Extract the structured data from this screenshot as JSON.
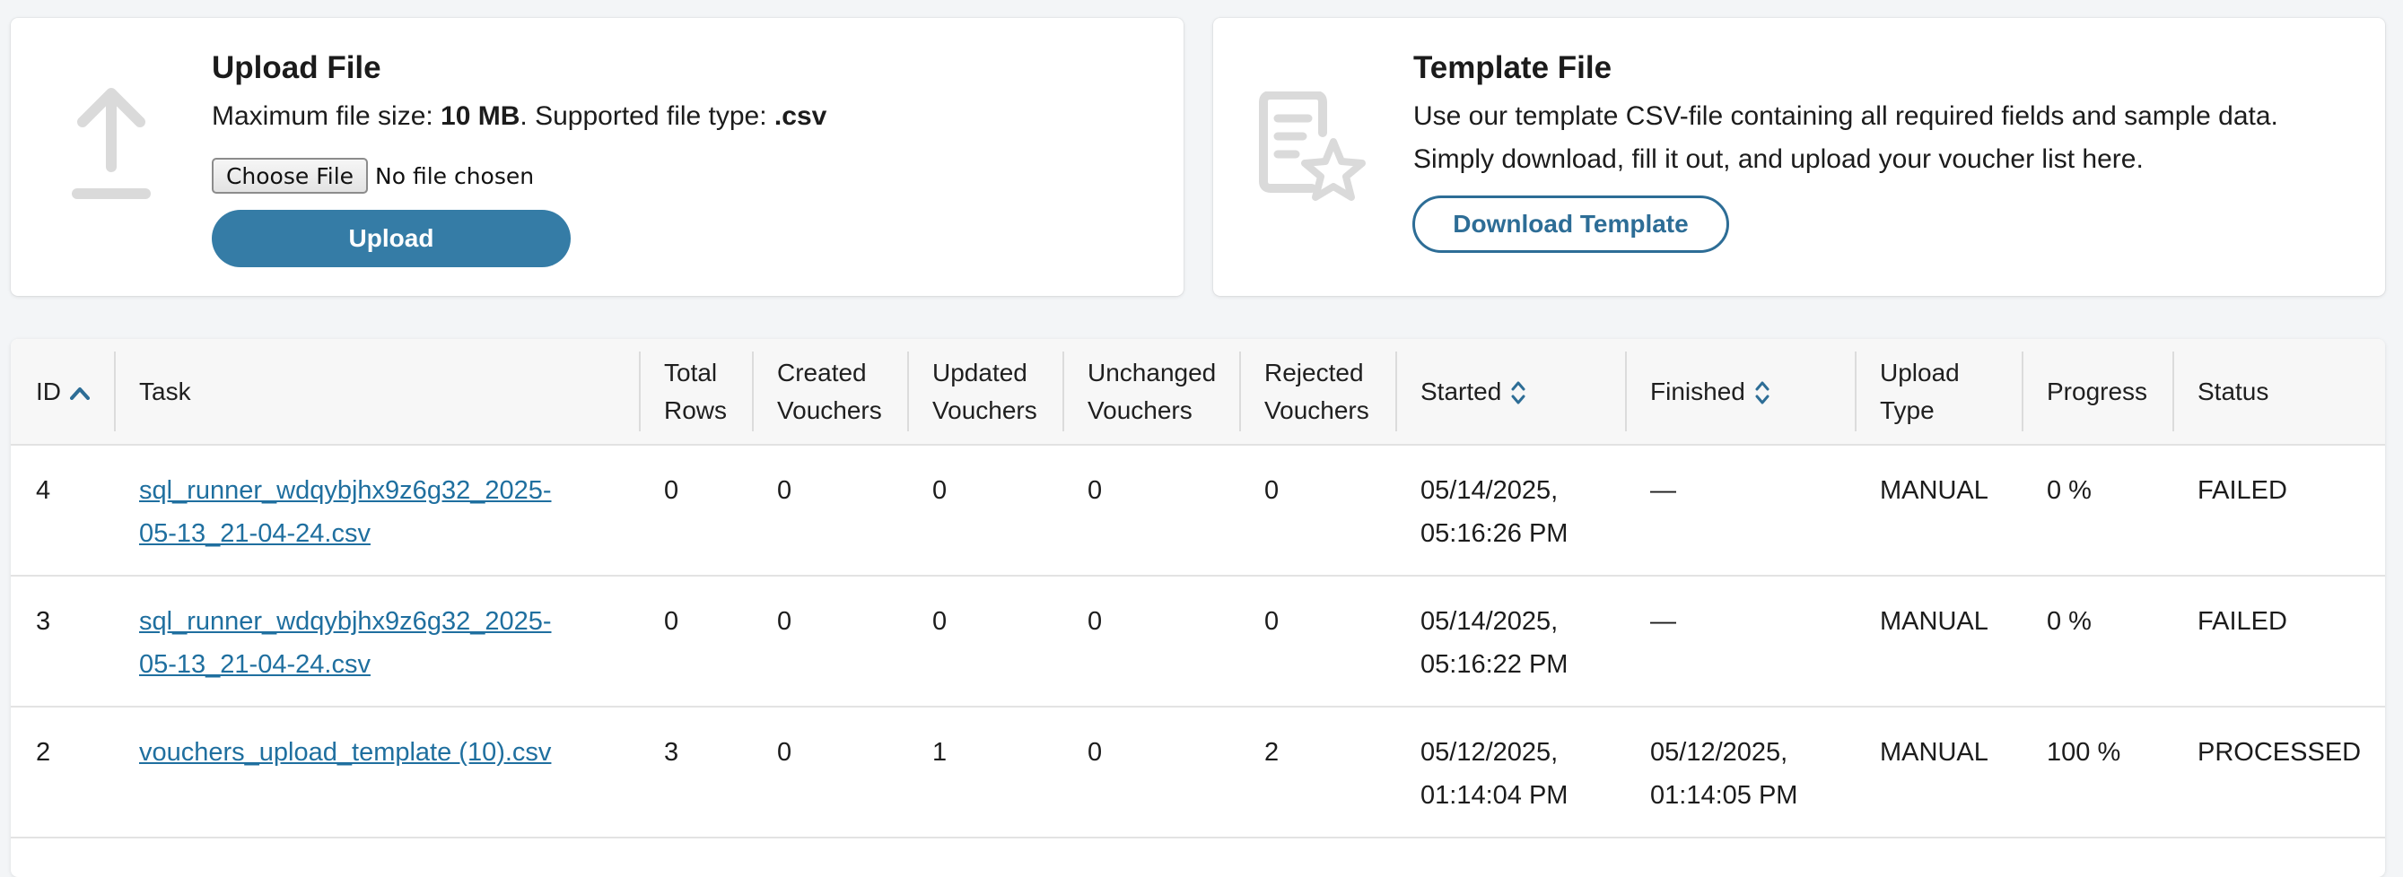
{
  "upload": {
    "title": "Upload File",
    "desc_prefix": "Maximum file size: ",
    "max_size": "10 MB",
    "desc_middle": ". Supported file type: ",
    "file_type": ".csv",
    "choose_file_label": "Choose File",
    "no_file_text": "No file chosen",
    "upload_button": "Upload"
  },
  "template": {
    "title": "Template File",
    "line1": "Use our template CSV-file containing all required fields and sample data.",
    "line2": "Simply download, fill it out, and upload your voucher list here.",
    "download_button": "Download Template"
  },
  "table": {
    "headers": {
      "id": "ID",
      "task": "Task",
      "total_rows_1": "Total",
      "total_rows_2": "Rows",
      "created_1": "Created",
      "created_2": "Vouchers",
      "updated_1": "Updated",
      "updated_2": "Vouchers",
      "unchanged_1": "Unchanged",
      "unchanged_2": "Vouchers",
      "rejected_1": "Rejected",
      "rejected_2": "Vouchers",
      "started": "Started",
      "finished": "Finished",
      "upload_type_1": "Upload",
      "upload_type_2": "Type",
      "progress": "Progress",
      "status": "Status"
    },
    "rows": [
      {
        "id": "4",
        "task_1": "sql_runner_wdqybjhx9z6g32_2025-",
        "task_2": "05-13_21-04-24.csv",
        "total_rows": "0",
        "created": "0",
        "updated": "0",
        "unchanged": "0",
        "rejected": "0",
        "started_1": "05/14/2025,",
        "started_2": "05:16:26 PM",
        "finished_1": "—",
        "finished_2": "",
        "upload_type": "MANUAL",
        "progress": "0 %",
        "status": "FAILED"
      },
      {
        "id": "3",
        "task_1": "sql_runner_wdqybjhx9z6g32_2025-",
        "task_2": "05-13_21-04-24.csv",
        "total_rows": "0",
        "created": "0",
        "updated": "0",
        "unchanged": "0",
        "rejected": "0",
        "started_1": "05/14/2025,",
        "started_2": "05:16:22 PM",
        "finished_1": "—",
        "finished_2": "",
        "upload_type": "MANUAL",
        "progress": "0 %",
        "status": "FAILED"
      },
      {
        "id": "2",
        "task_1": "vouchers_upload_template (10).csv",
        "task_2": "",
        "total_rows": "3",
        "created": "0",
        "updated": "1",
        "unchanged": "0",
        "rejected": "2",
        "started_1": "05/12/2025,",
        "started_2": "01:14:04 PM",
        "finished_1": "05/12/2025,",
        "finished_2": "01:14:05 PM",
        "upload_type": "MANUAL",
        "progress": "100 %",
        "status": "PROCESSED"
      }
    ]
  },
  "colors": {
    "primary": "#357ca6",
    "link": "#1f6f9f",
    "icon_gray": "#dadada"
  },
  "icons": {
    "upload": "upload-arrow-icon",
    "template": "document-star-icon",
    "sort_asc": "chevron-up-icon",
    "sort_both": "sort-updown-icon"
  }
}
